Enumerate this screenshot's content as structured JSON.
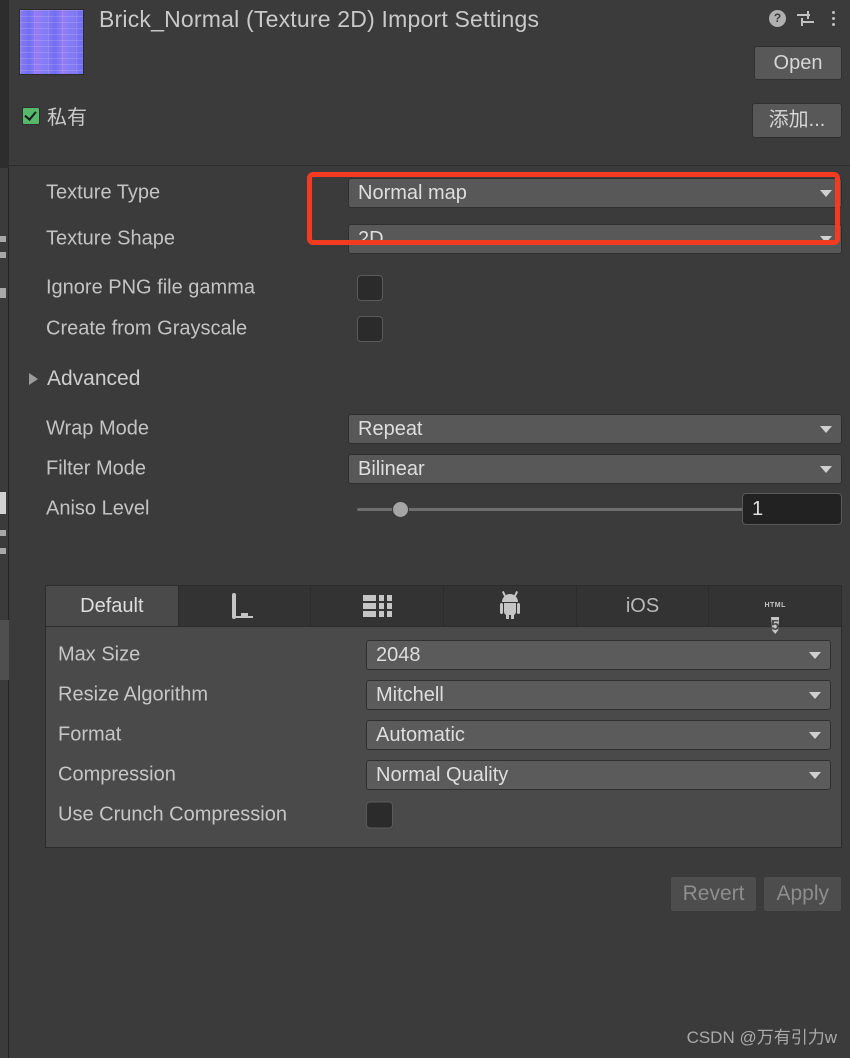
{
  "window": {
    "title": "Brick_Normal (Texture 2D) Import Settings",
    "thumbnail_alt": "brick-normal-map-thumbnail",
    "accent_highlight_color": "#f23b20",
    "background_color": "#3b3b3b"
  },
  "header": {
    "icons": {
      "help": "?",
      "help_name": "help-icon",
      "preset": "preset-icon",
      "menu": "kebab-menu-icon"
    },
    "open_button": "Open",
    "add_button": "添加...",
    "private_checkbox": {
      "label": "私有",
      "checked": true,
      "check_color": "#55b86b"
    }
  },
  "settings": {
    "texture_type": {
      "label": "Texture Type",
      "value": "Normal map",
      "highlighted": true
    },
    "texture_shape": {
      "label": "Texture Shape",
      "value": "2D"
    },
    "ignore_png_gamma": {
      "label": "Ignore PNG file gamma",
      "checked": false
    },
    "create_from_grayscale": {
      "label": "Create from Grayscale",
      "checked": false
    },
    "advanced": {
      "label": "Advanced",
      "expanded": false
    },
    "wrap_mode": {
      "label": "Wrap Mode",
      "value": "Repeat"
    },
    "filter_mode": {
      "label": "Filter Mode",
      "value": "Bilinear"
    },
    "aniso_level": {
      "label": "Aniso Level",
      "value": "1",
      "slider_percent": 9
    }
  },
  "platform_tabs": {
    "active": "Default",
    "items": [
      {
        "label": "Default",
        "icon": "default-text",
        "active": true
      },
      {
        "label": "",
        "icon": "monitor-icon",
        "active": false
      },
      {
        "label": "",
        "icon": "server-icon",
        "active": false
      },
      {
        "label": "",
        "icon": "android-icon",
        "active": false
      },
      {
        "label": "iOS",
        "icon": "ios-text",
        "active": false
      },
      {
        "label": "",
        "icon": "html5-icon",
        "active": false
      }
    ]
  },
  "platform_settings": {
    "max_size": {
      "label": "Max Size",
      "value": "2048"
    },
    "resize_algorithm": {
      "label": "Resize Algorithm",
      "value": "Mitchell"
    },
    "format": {
      "label": "Format",
      "value": "Automatic"
    },
    "compression": {
      "label": "Compression",
      "value": "Normal Quality"
    },
    "use_crunch_compression": {
      "label": "Use Crunch Compression",
      "checked": false
    }
  },
  "footer": {
    "revert_button": "Revert",
    "apply_button": "Apply",
    "watermark": "CSDN @万有引力w"
  },
  "html5_icon": {
    "word": "HTML",
    "digit": "5"
  }
}
